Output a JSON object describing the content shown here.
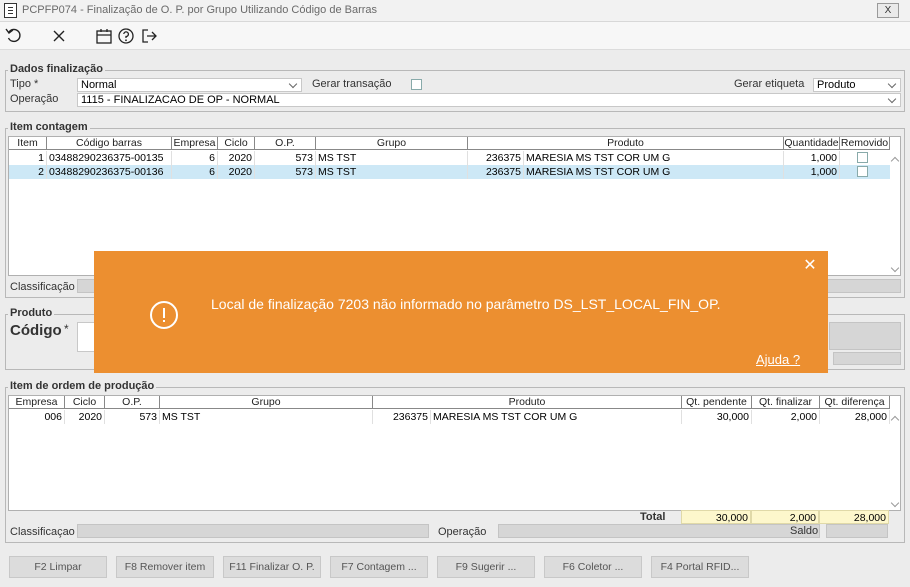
{
  "window": {
    "title": "PCPFP074 - Finalização de O. P.  por Grupo Utilizando Código de Barras",
    "close_label": "X"
  },
  "dados_finalizacao": {
    "legend": "Dados finalização",
    "tipo_label": "Tipo *",
    "tipo_value": "Normal",
    "gerar_transacao_label": "Gerar transação",
    "gerar_etiqueta_label": "Gerar etiqueta",
    "gerar_etiqueta_value": "Produto",
    "operacao_label": "Operação",
    "operacao_value": "1115 - FINALIZACAO DE OP - NORMAL"
  },
  "item_contagem": {
    "legend": "Item contagem",
    "headers": [
      "Item",
      "Código barras",
      "Empresa",
      "Ciclo",
      "O.P.",
      "Grupo",
      "Produto",
      "Quantidade",
      "Removido"
    ],
    "rows": [
      {
        "item": "1",
        "codigo": "03488290236375-00135",
        "empresa": "6",
        "ciclo": "2020",
        "op": "573",
        "grupo": "MS TST",
        "prod_code": "236375",
        "prod_desc": "MARESIA MS TST COR UM G",
        "quantidade": "1,000"
      },
      {
        "item": "2",
        "codigo": "03488290236375-00136",
        "empresa": "6",
        "ciclo": "2020",
        "op": "573",
        "grupo": "MS TST",
        "prod_code": "236375",
        "prod_desc": "MARESIA MS TST COR UM G",
        "quantidade": "1,000"
      }
    ],
    "classificacao_label": "Classificação"
  },
  "produto": {
    "legend": "Produto",
    "codigo_label": "Código",
    "required_mark": "*"
  },
  "item_op": {
    "legend": "Item de ordem de produção",
    "headers": [
      "Empresa",
      "Ciclo",
      "O.P.",
      "Grupo",
      "Produto",
      "Qt. pendente",
      "Qt. finalizar",
      "Qt. diferença"
    ],
    "rows": [
      {
        "empresa": "006",
        "ciclo": "2020",
        "op": "573",
        "grupo": "MS TST",
        "prod_code": "236375",
        "prod_desc": "MARESIA MS TST COR UM G",
        "pendente": "30,000",
        "finalizar": "2,000",
        "diferenca": "28,000"
      }
    ],
    "total_label": "Total",
    "total_pendente": "30,000",
    "total_finalizar": "2,000",
    "total_diferenca": "28,000",
    "classificacao_label": "Classificaçao",
    "operacao_label": "Operação",
    "saldo_label": "Saldo"
  },
  "buttons": [
    "F2 Limpar",
    "F8 Remover item",
    "F11 Finalizar O. P.",
    "F7 Contagem ...",
    "F9 Sugerir ...",
    "F6 Coletor ...",
    "F4 Portal RFID..."
  ],
  "message": {
    "text": "Local de finalização 7203 não informado no parâmetro DS_LST_LOCAL_FIN_OP.",
    "help": "Ajuda ?",
    "close": "✕",
    "background": "#ec8f30"
  },
  "toolbar_icons": [
    "undo-icon",
    "close-icon",
    "calendar-icon",
    "help-icon",
    "exit-icon"
  ]
}
